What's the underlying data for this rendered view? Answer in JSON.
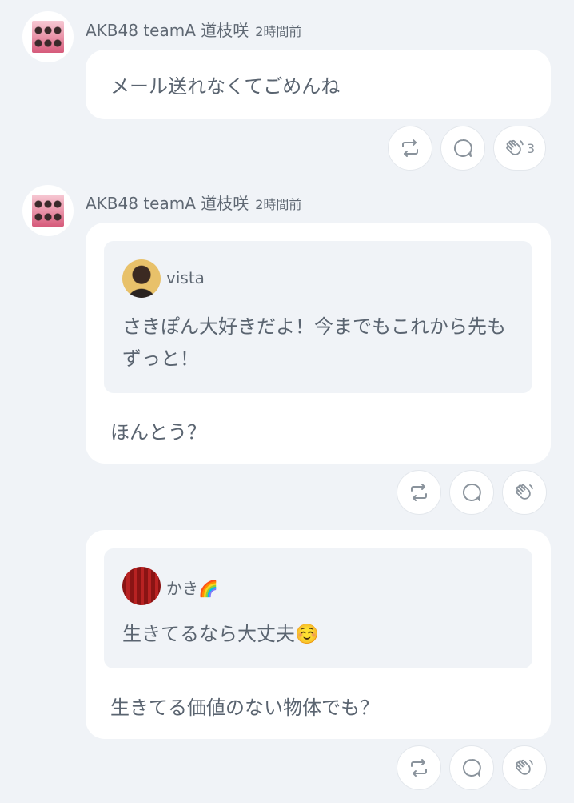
{
  "posts": [
    {
      "author": "AKB48 teamA 道枝咲",
      "time": "2時間前",
      "message": "メール送れなくてごめんね",
      "clap_count": "3"
    },
    {
      "author": "AKB48 teamA 道枝咲",
      "time": "2時間前",
      "quote": {
        "name": "vista",
        "text": "さきぽん大好きだよ！今までもこれから先もずっと！"
      },
      "message": "ほんとう？"
    },
    {
      "quote": {
        "name": "かき🌈",
        "text": "生きてるなら大丈夫☺️"
      },
      "message": "生きてる価値のない物体でも？"
    }
  ],
  "colors": {
    "background": "#f0f3f7",
    "bubble": "#ffffff",
    "text": "#5a6470",
    "icon": "#8a939c"
  },
  "icons": {
    "repost": "repost-icon",
    "comment": "comment-icon",
    "clap": "clap-icon"
  }
}
